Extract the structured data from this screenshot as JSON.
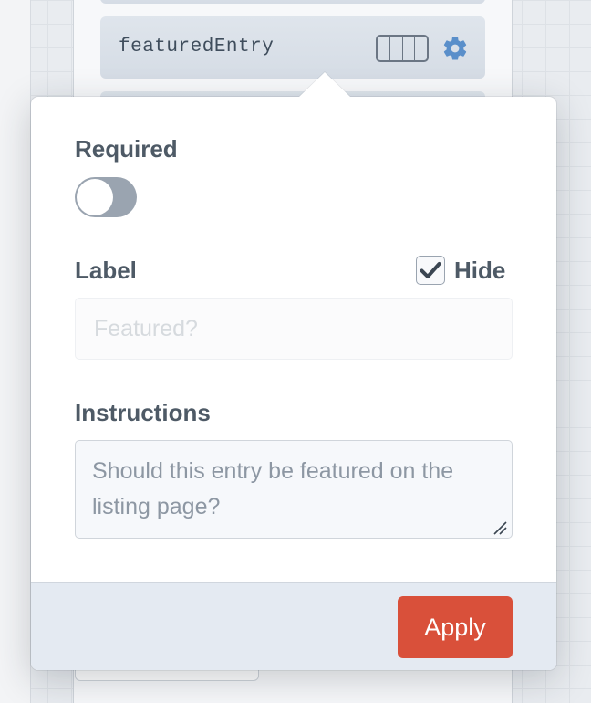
{
  "field_layout": {
    "field": {
      "handle": "featuredEntry"
    },
    "icons": {
      "width_selector": "field-width-icon",
      "settings": "gear-icon"
    }
  },
  "hud": {
    "required": {
      "label": "Required",
      "enabled": false
    },
    "label_field": {
      "label": "Label",
      "value": "",
      "placeholder": "Featured?",
      "hide_label": "Hide",
      "hide_checked": true
    },
    "instructions": {
      "label": "Instructions",
      "value": "Should this entry be featured on the listing page?"
    },
    "apply_label": "Apply"
  },
  "colors": {
    "accent_apply": "#d9503a",
    "gear_blue": "#5a8fca",
    "text_heading": "#4e5a66",
    "toggle_off": "#9aa4b0"
  }
}
